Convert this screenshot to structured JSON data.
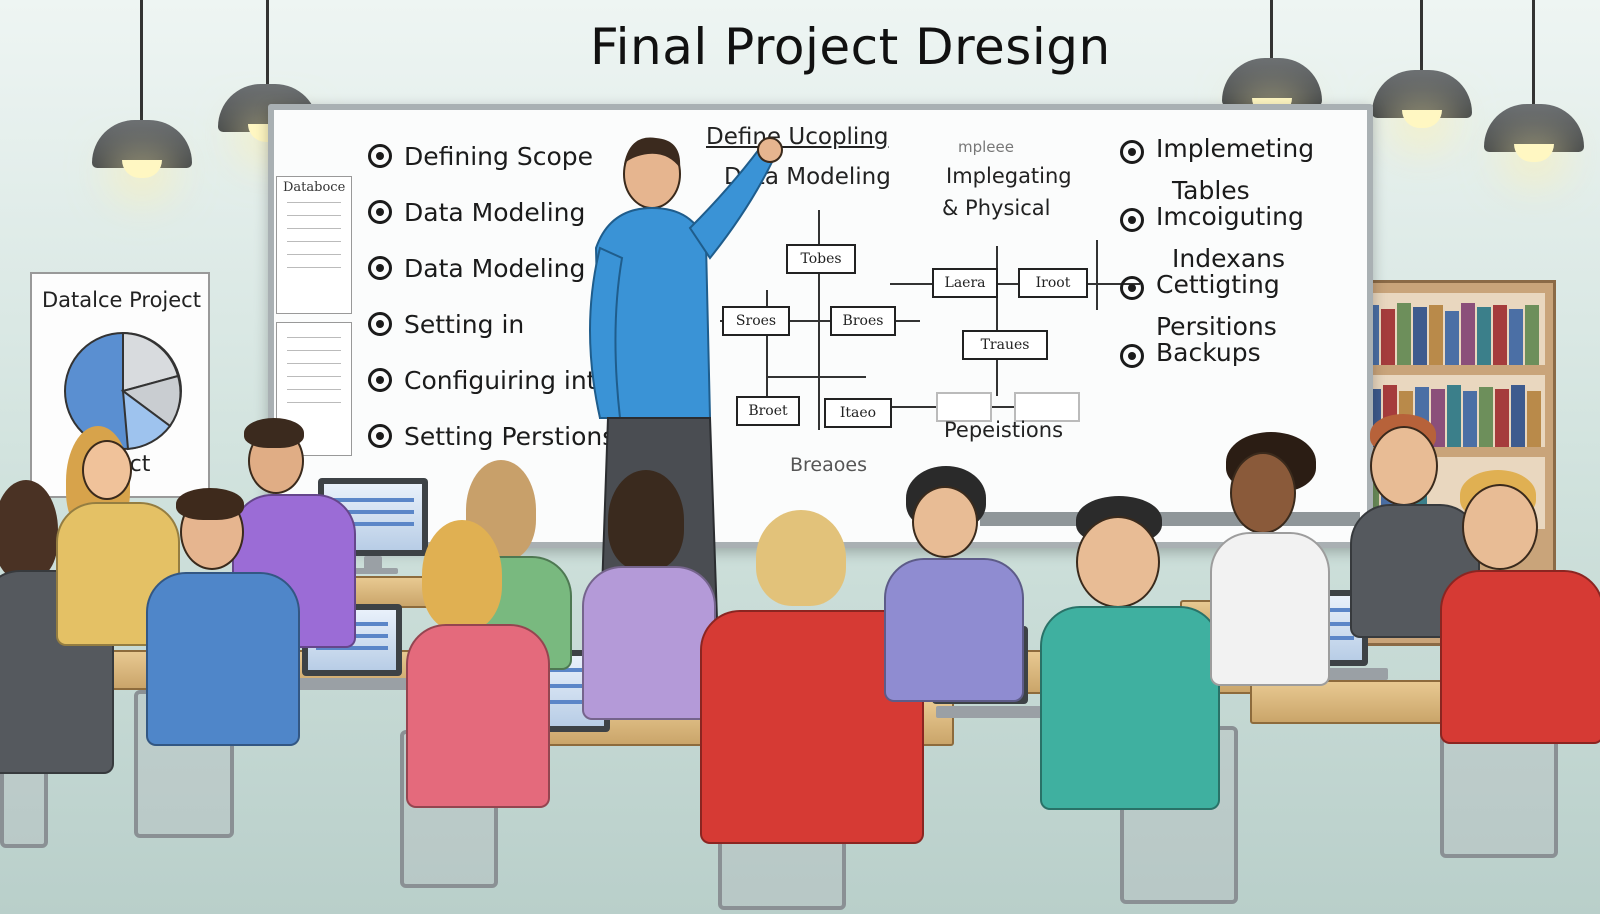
{
  "title": "Final Project Dresign",
  "board": {
    "left_list": [
      "Defining Scope",
      "Data Modeling",
      "Data Modeling",
      "Setting  in",
      "Configuiring int",
      "Setting Perstions"
    ],
    "center_heading_1": "Define Ucopling",
    "center_heading_2": "Data Modeling",
    "center_heading_3": "mpleee",
    "center_heading_4": "Implegating",
    "center_heading_5": "& Physical",
    "diagram_boxes": [
      "Tobes",
      "Sroes",
      "Broes",
      "Laera",
      "Iroot",
      "Traues",
      "Broet",
      "Itaeo"
    ],
    "diagram_bottom_1": "Breaoes",
    "diagram_bottom_2": "Pepeistions",
    "right_list": [
      {
        "line1": "Implemeting",
        "line2": "Tables"
      },
      {
        "line1": "Imcoiguting",
        "line2": "Indexans"
      },
      {
        "line1": "Cettigting",
        "line2": "Persitions"
      },
      {
        "line1": "Backups",
        "line2": ""
      }
    ],
    "sheet_header": "Databoce"
  },
  "poster": {
    "title": "Datalce Project",
    "footer": "ject"
  },
  "colors": {
    "teacher_shirt": "#3a93d6",
    "board_bg": "#fbfcfc",
    "wall": "#cfe1dc"
  }
}
